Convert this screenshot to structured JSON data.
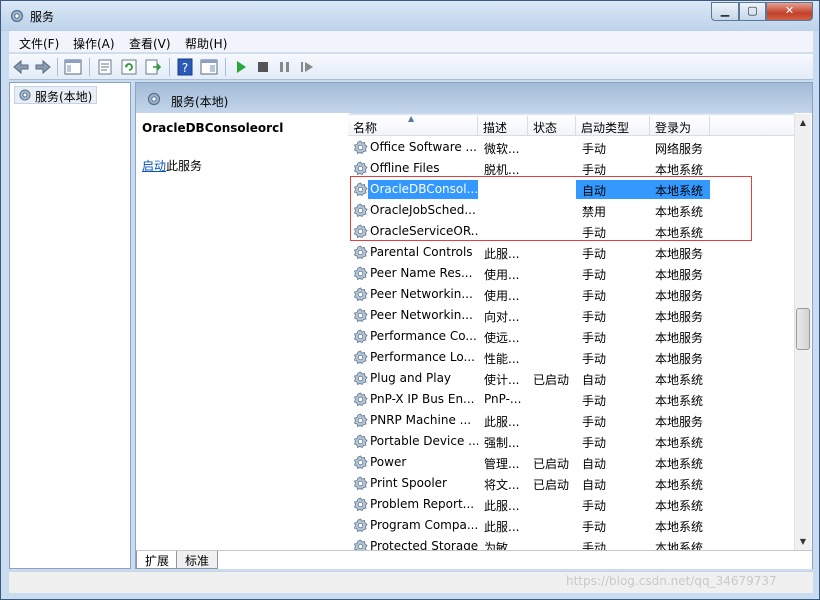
{
  "window": {
    "title": "服务"
  },
  "menu": [
    "文件(F)",
    "操作(A)",
    "查看(V)",
    "帮助(H)"
  ],
  "tree": {
    "item": "服务(本地)"
  },
  "header": {
    "title": "服务(本地)"
  },
  "description": {
    "service_name": "OracleDBConsoleorcl",
    "start_link": "启动",
    "start_suffix": "此服务"
  },
  "columns": [
    "名称",
    "描述",
    "状态",
    "启动类型",
    "登录为"
  ],
  "rows": [
    {
      "name": "Office Software ...",
      "desc": "微软...",
      "status": "",
      "startup": "手动",
      "logon": "网络服务"
    },
    {
      "name": "Offline Files",
      "desc": "脱机...",
      "status": "",
      "startup": "手动",
      "logon": "本地系统"
    },
    {
      "name": "OracleDBConsol...",
      "desc": "",
      "status": "",
      "startup": "自动",
      "logon": "本地系统"
    },
    {
      "name": "OracleJobSched...",
      "desc": "",
      "status": "",
      "startup": "禁用",
      "logon": "本地系统"
    },
    {
      "name": "OracleServiceOR...",
      "desc": "",
      "status": "",
      "startup": "手动",
      "logon": "本地系统"
    },
    {
      "name": "Parental Controls",
      "desc": "此服...",
      "status": "",
      "startup": "手动",
      "logon": "本地服务"
    },
    {
      "name": "Peer Name Res...",
      "desc": "使用...",
      "status": "",
      "startup": "手动",
      "logon": "本地服务"
    },
    {
      "name": "Peer Networkin...",
      "desc": "使用...",
      "status": "",
      "startup": "手动",
      "logon": "本地服务"
    },
    {
      "name": "Peer Networkin...",
      "desc": "向对...",
      "status": "",
      "startup": "手动",
      "logon": "本地服务"
    },
    {
      "name": "Performance Co...",
      "desc": "使远...",
      "status": "",
      "startup": "手动",
      "logon": "本地服务"
    },
    {
      "name": "Performance Lo...",
      "desc": "性能...",
      "status": "",
      "startup": "手动",
      "logon": "本地服务"
    },
    {
      "name": "Plug and Play",
      "desc": "使计...",
      "status": "已启动",
      "startup": "自动",
      "logon": "本地系统"
    },
    {
      "name": "PnP-X IP Bus En...",
      "desc": "PnP-...",
      "status": "",
      "startup": "手动",
      "logon": "本地系统"
    },
    {
      "name": "PNRP Machine ...",
      "desc": "此服...",
      "status": "",
      "startup": "手动",
      "logon": "本地服务"
    },
    {
      "name": "Portable Device ...",
      "desc": "强制...",
      "status": "",
      "startup": "手动",
      "logon": "本地系统"
    },
    {
      "name": "Power",
      "desc": "管理...",
      "status": "已启动",
      "startup": "自动",
      "logon": "本地系统"
    },
    {
      "name": "Print Spooler",
      "desc": "将文...",
      "status": "已启动",
      "startup": "自动",
      "logon": "本地系统"
    },
    {
      "name": "Problem Report...",
      "desc": "此服...",
      "status": "",
      "startup": "手动",
      "logon": "本地系统"
    },
    {
      "name": "Program Compa...",
      "desc": "此服...",
      "status": "",
      "startup": "手动",
      "logon": "本地系统"
    },
    {
      "name": "Protected Storage",
      "desc": "为敏...",
      "status": "",
      "startup": "手动",
      "logon": "本地系统"
    }
  ],
  "tabs": [
    "扩展",
    "标准"
  ],
  "watermark": "https://blog.csdn.net/qq_34679737"
}
